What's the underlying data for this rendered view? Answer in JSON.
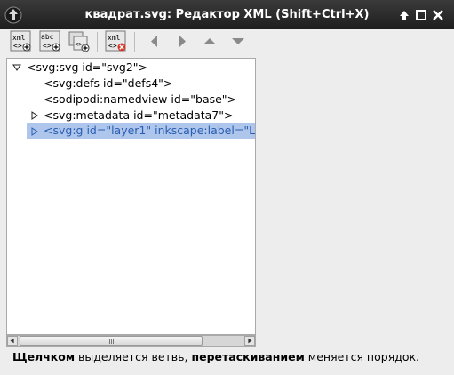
{
  "window": {
    "title": "квадрат.svg: Редактор XML (Shift+Ctrl+X)"
  },
  "toolbar": {
    "buttons": [
      {
        "icon": "new-element-node-icon",
        "label": "xml"
      },
      {
        "icon": "new-text-node-icon",
        "label": "abc"
      },
      {
        "icon": "duplicate-node-icon",
        "label": ""
      },
      {
        "icon": "delete-node-icon",
        "label": "xml"
      },
      {
        "icon": "unindent-node-icon",
        "label": ""
      },
      {
        "icon": "indent-node-icon",
        "label": ""
      },
      {
        "icon": "raise-node-icon",
        "label": ""
      },
      {
        "icon": "lower-node-icon",
        "label": ""
      }
    ]
  },
  "tree": {
    "nodes": [
      {
        "text": "<svg:svg id=\"svg2\">",
        "expander": "expanded",
        "selected": false
      },
      {
        "text": "<svg:defs id=\"defs4\">",
        "expander": "none",
        "selected": false
      },
      {
        "text": "<sodipodi:namedview id=\"base\">",
        "expander": "none",
        "selected": false
      },
      {
        "text": "<svg:metadata id=\"metadata7\">",
        "expander": "collapsed",
        "selected": false
      },
      {
        "text": "<svg:g id=\"layer1\" inkscape:label=\"L",
        "expander": "collapsed",
        "selected": true
      }
    ]
  },
  "status": {
    "part1": "Щелчком",
    "part2": " выделяется ветвь, ",
    "part3": "перетаскиванием",
    "part4": " меняется порядок."
  },
  "colors": {
    "titlebar": "#2b2b2b",
    "selection": "#aec6ec",
    "selection_text": "#2a5db0"
  }
}
